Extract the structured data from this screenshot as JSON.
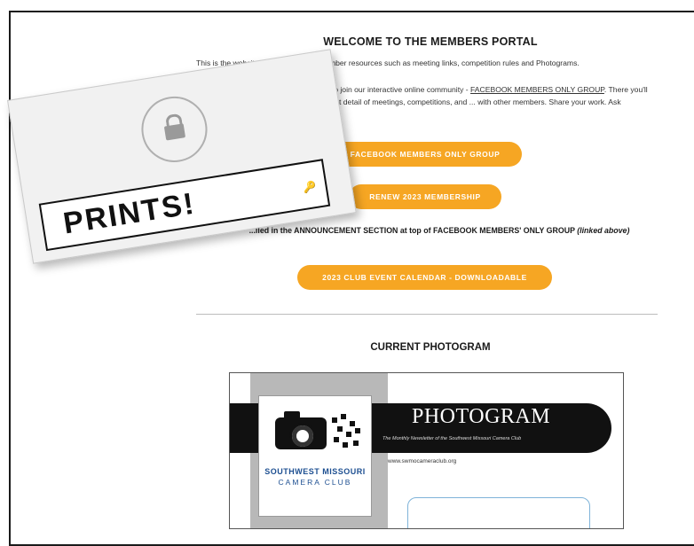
{
  "portal": {
    "title": "WELCOME TO THE MEMBERS PORTAL",
    "intro": "This is the website hub for SWMCC member resources such as meeting links, competition rules and Photograms.",
    "p2_prefix": "For maximum benefit, we ask members to join our interactive online community - ",
    "p2_link": "FACEBOOK MEMBERS ONLY GROUP",
    "p2_suffix": ". There you'll find up-to-the-minute updates with greatest detail of meetings, competitions, and ... with other members. Share your work. Ask questions.",
    "btn_facebook": "FACEBOOK MEMBERS ONLY GROUP",
    "btn_renew": "RENEW 2023 MEMBERSHIP",
    "announce_text": "...lled in the ANNOUNCEMENT SECTION at top of FACEBOOK MEMBERS' ONLY GROUP ",
    "announce_em": "(linked above)",
    "btn_calendar": "2023 CLUB EVENT CALENDAR - DOWNLOADABLE",
    "current_heading": "CURRENT PHOTOGRAM"
  },
  "photogram": {
    "title": "PHOTOGRAM",
    "subtitle": "The Monthly Newsletter of the Southwest Missouri Camera Club",
    "url": "www.swmocameraclub.org",
    "logo_line1": "SOUTHWEST MISSOURI",
    "logo_line2": "CAMERA CLUB"
  },
  "password_card": {
    "value": "PRINTS!",
    "lock_icon": "lock-icon",
    "key_icon": "key-icon"
  },
  "colors": {
    "accent": "#f6a623",
    "logo_blue": "#1d4f91"
  }
}
